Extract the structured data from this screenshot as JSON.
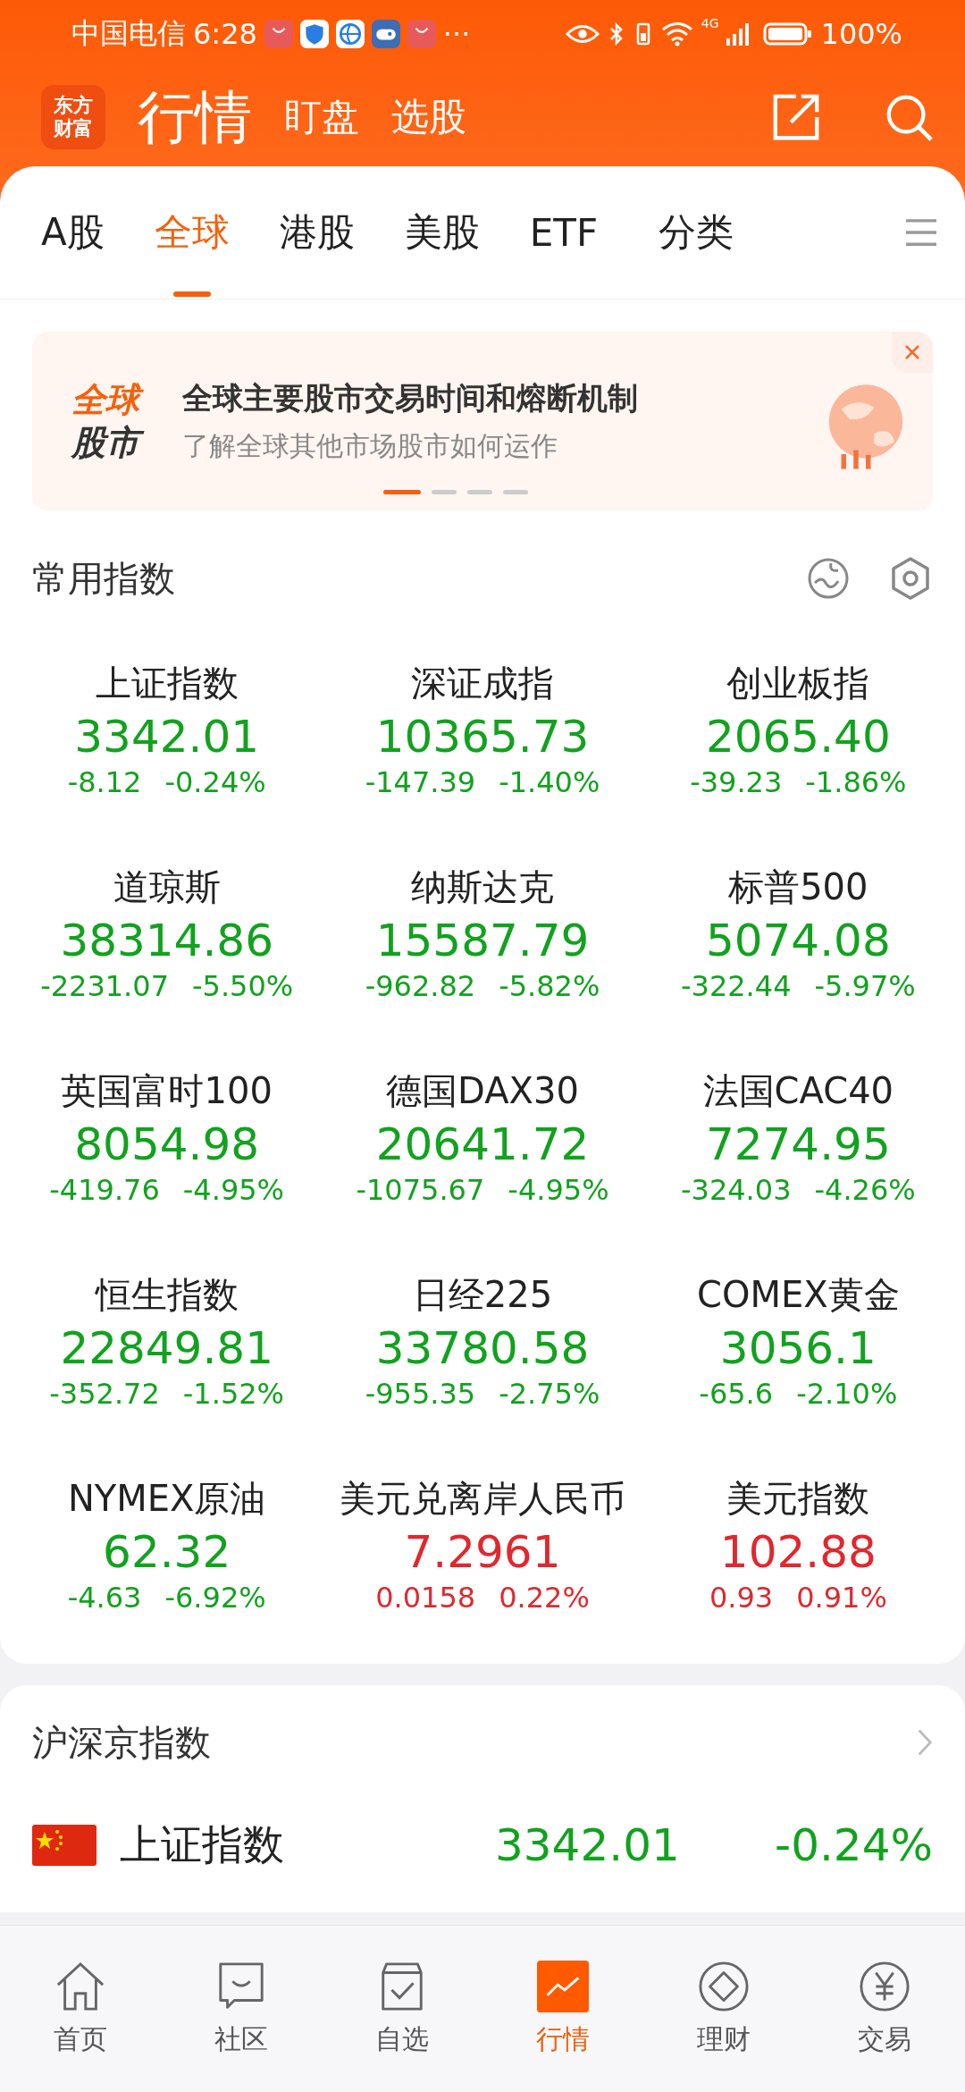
{
  "status_bar": {
    "carrier": "中国电信",
    "time": "6:28",
    "more": "···",
    "network": "4G",
    "battery": "100%"
  },
  "header": {
    "logo": "东方财富",
    "tabs": [
      {
        "label": "行情",
        "selected": true
      },
      {
        "label": "盯盘",
        "selected": false
      },
      {
        "label": "选股",
        "selected": false
      }
    ]
  },
  "market_tabs": [
    {
      "label": "A股",
      "selected": false
    },
    {
      "label": "全球",
      "selected": true
    },
    {
      "label": "港股",
      "selected": false
    },
    {
      "label": "美股",
      "selected": false
    },
    {
      "label": "ETF",
      "selected": false
    }
  ],
  "category_button": "分类",
  "banner": {
    "badge_top": "全球",
    "badge_bottom": "股市",
    "title": "全球主要股市交易时间和熔断机制",
    "subtitle": "了解全球其他市场股市如何运作",
    "dots": [
      {
        "selected": true
      },
      {
        "selected": false
      },
      {
        "selected": false
      },
      {
        "selected": false
      }
    ]
  },
  "common_indices": {
    "title": "常用指数",
    "items": [
      {
        "name": "上证指数",
        "value": "3342.01",
        "change": "-8.12",
        "percent": "-0.24%",
        "kind": "down"
      },
      {
        "name": "深证成指",
        "value": "10365.73",
        "change": "-147.39",
        "percent": "-1.40%",
        "kind": "down"
      },
      {
        "name": "创业板指",
        "value": "2065.40",
        "change": "-39.23",
        "percent": "-1.86%",
        "kind": "down"
      },
      {
        "name": "道琼斯",
        "value": "38314.86",
        "change": "-2231.07",
        "percent": "-5.50%",
        "kind": "down"
      },
      {
        "name": "纳斯达克",
        "value": "15587.79",
        "change": "-962.82",
        "percent": "-5.82%",
        "kind": "down"
      },
      {
        "name": "标普500",
        "value": "5074.08",
        "change": "-322.44",
        "percent": "-5.97%",
        "kind": "down"
      },
      {
        "name": "英国富时100",
        "value": "8054.98",
        "change": "-419.76",
        "percent": "-4.95%",
        "kind": "down"
      },
      {
        "name": "德国DAX30",
        "value": "20641.72",
        "change": "-1075.67",
        "percent": "-4.95%",
        "kind": "down"
      },
      {
        "name": "法国CAC40",
        "value": "7274.95",
        "change": "-324.03",
        "percent": "-4.26%",
        "kind": "down"
      },
      {
        "name": "恒生指数",
        "value": "22849.81",
        "change": "-352.72",
        "percent": "-1.52%",
        "kind": "down"
      },
      {
        "name": "日经225",
        "value": "33780.58",
        "change": "-955.35",
        "percent": "-2.75%",
        "kind": "down"
      },
      {
        "name": "COMEX黄金",
        "value": "3056.1",
        "change": "-65.6",
        "percent": "-2.10%",
        "kind": "down"
      },
      {
        "name": "NYMEX原油",
        "value": "62.32",
        "change": "-4.63",
        "percent": "-6.92%",
        "kind": "down"
      },
      {
        "name": "美元兑离岸人民币",
        "value": "7.2961",
        "change": "0.0158",
        "percent": "0.22%",
        "kind": "up"
      },
      {
        "name": "美元指数",
        "value": "102.88",
        "change": "0.93",
        "percent": "0.91%",
        "kind": "up"
      }
    ]
  },
  "hs_indices": {
    "title": "沪深京指数",
    "rows": [
      {
        "name": "上证指数",
        "value": "3342.01",
        "percent": "-0.24%",
        "kind": "down"
      }
    ]
  },
  "bottom_nav": [
    {
      "label": "首页",
      "kind": "home",
      "selected": false
    },
    {
      "label": "社区",
      "kind": "chat",
      "selected": false
    },
    {
      "label": "自选",
      "kind": "check",
      "selected": false
    },
    {
      "label": "行情",
      "kind": "chart",
      "selected": true
    },
    {
      "label": "理财",
      "kind": "diamond",
      "selected": false
    },
    {
      "label": "交易",
      "kind": "yen",
      "selected": false
    }
  ]
}
